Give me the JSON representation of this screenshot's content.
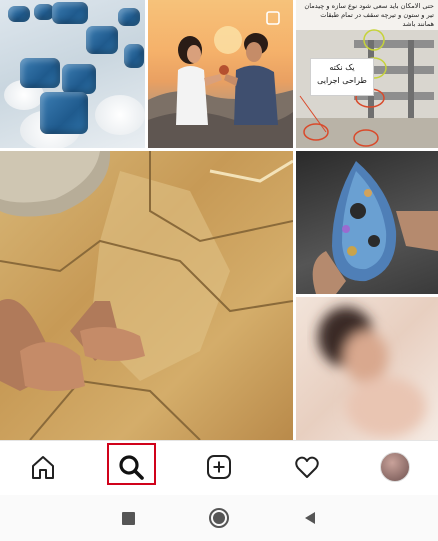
{
  "feed": {
    "tiles": [
      {
        "name": "blue-crystals"
      },
      {
        "name": "couple-sunset"
      },
      {
        "name": "persian-construction-post"
      },
      {
        "name": "hands-on-rock"
      },
      {
        "name": "opal-gemstone"
      },
      {
        "name": "blurred-portrait"
      }
    ],
    "persian_post": {
      "lines": [
        "حتی الامکان باید سعی شود نوع سازه و چیدمان",
        "تیر و ستون و تیرچه سقف در تمام طبقات",
        "همانند باشد"
      ],
      "card_title": "یک نکته",
      "card_subtitle": "طراحی اجرایی"
    }
  },
  "bottom_nav": {
    "items": [
      {
        "icon": "home-icon"
      },
      {
        "icon": "search-icon",
        "active": true
      },
      {
        "icon": "add-post-icon"
      },
      {
        "icon": "heart-icon"
      },
      {
        "icon": "profile-avatar"
      }
    ],
    "highlight_color": "#d0021b"
  },
  "system_nav": {
    "items": [
      {
        "icon": "recents-square-icon"
      },
      {
        "icon": "home-circle-icon"
      },
      {
        "icon": "back-triangle-icon"
      }
    ]
  }
}
